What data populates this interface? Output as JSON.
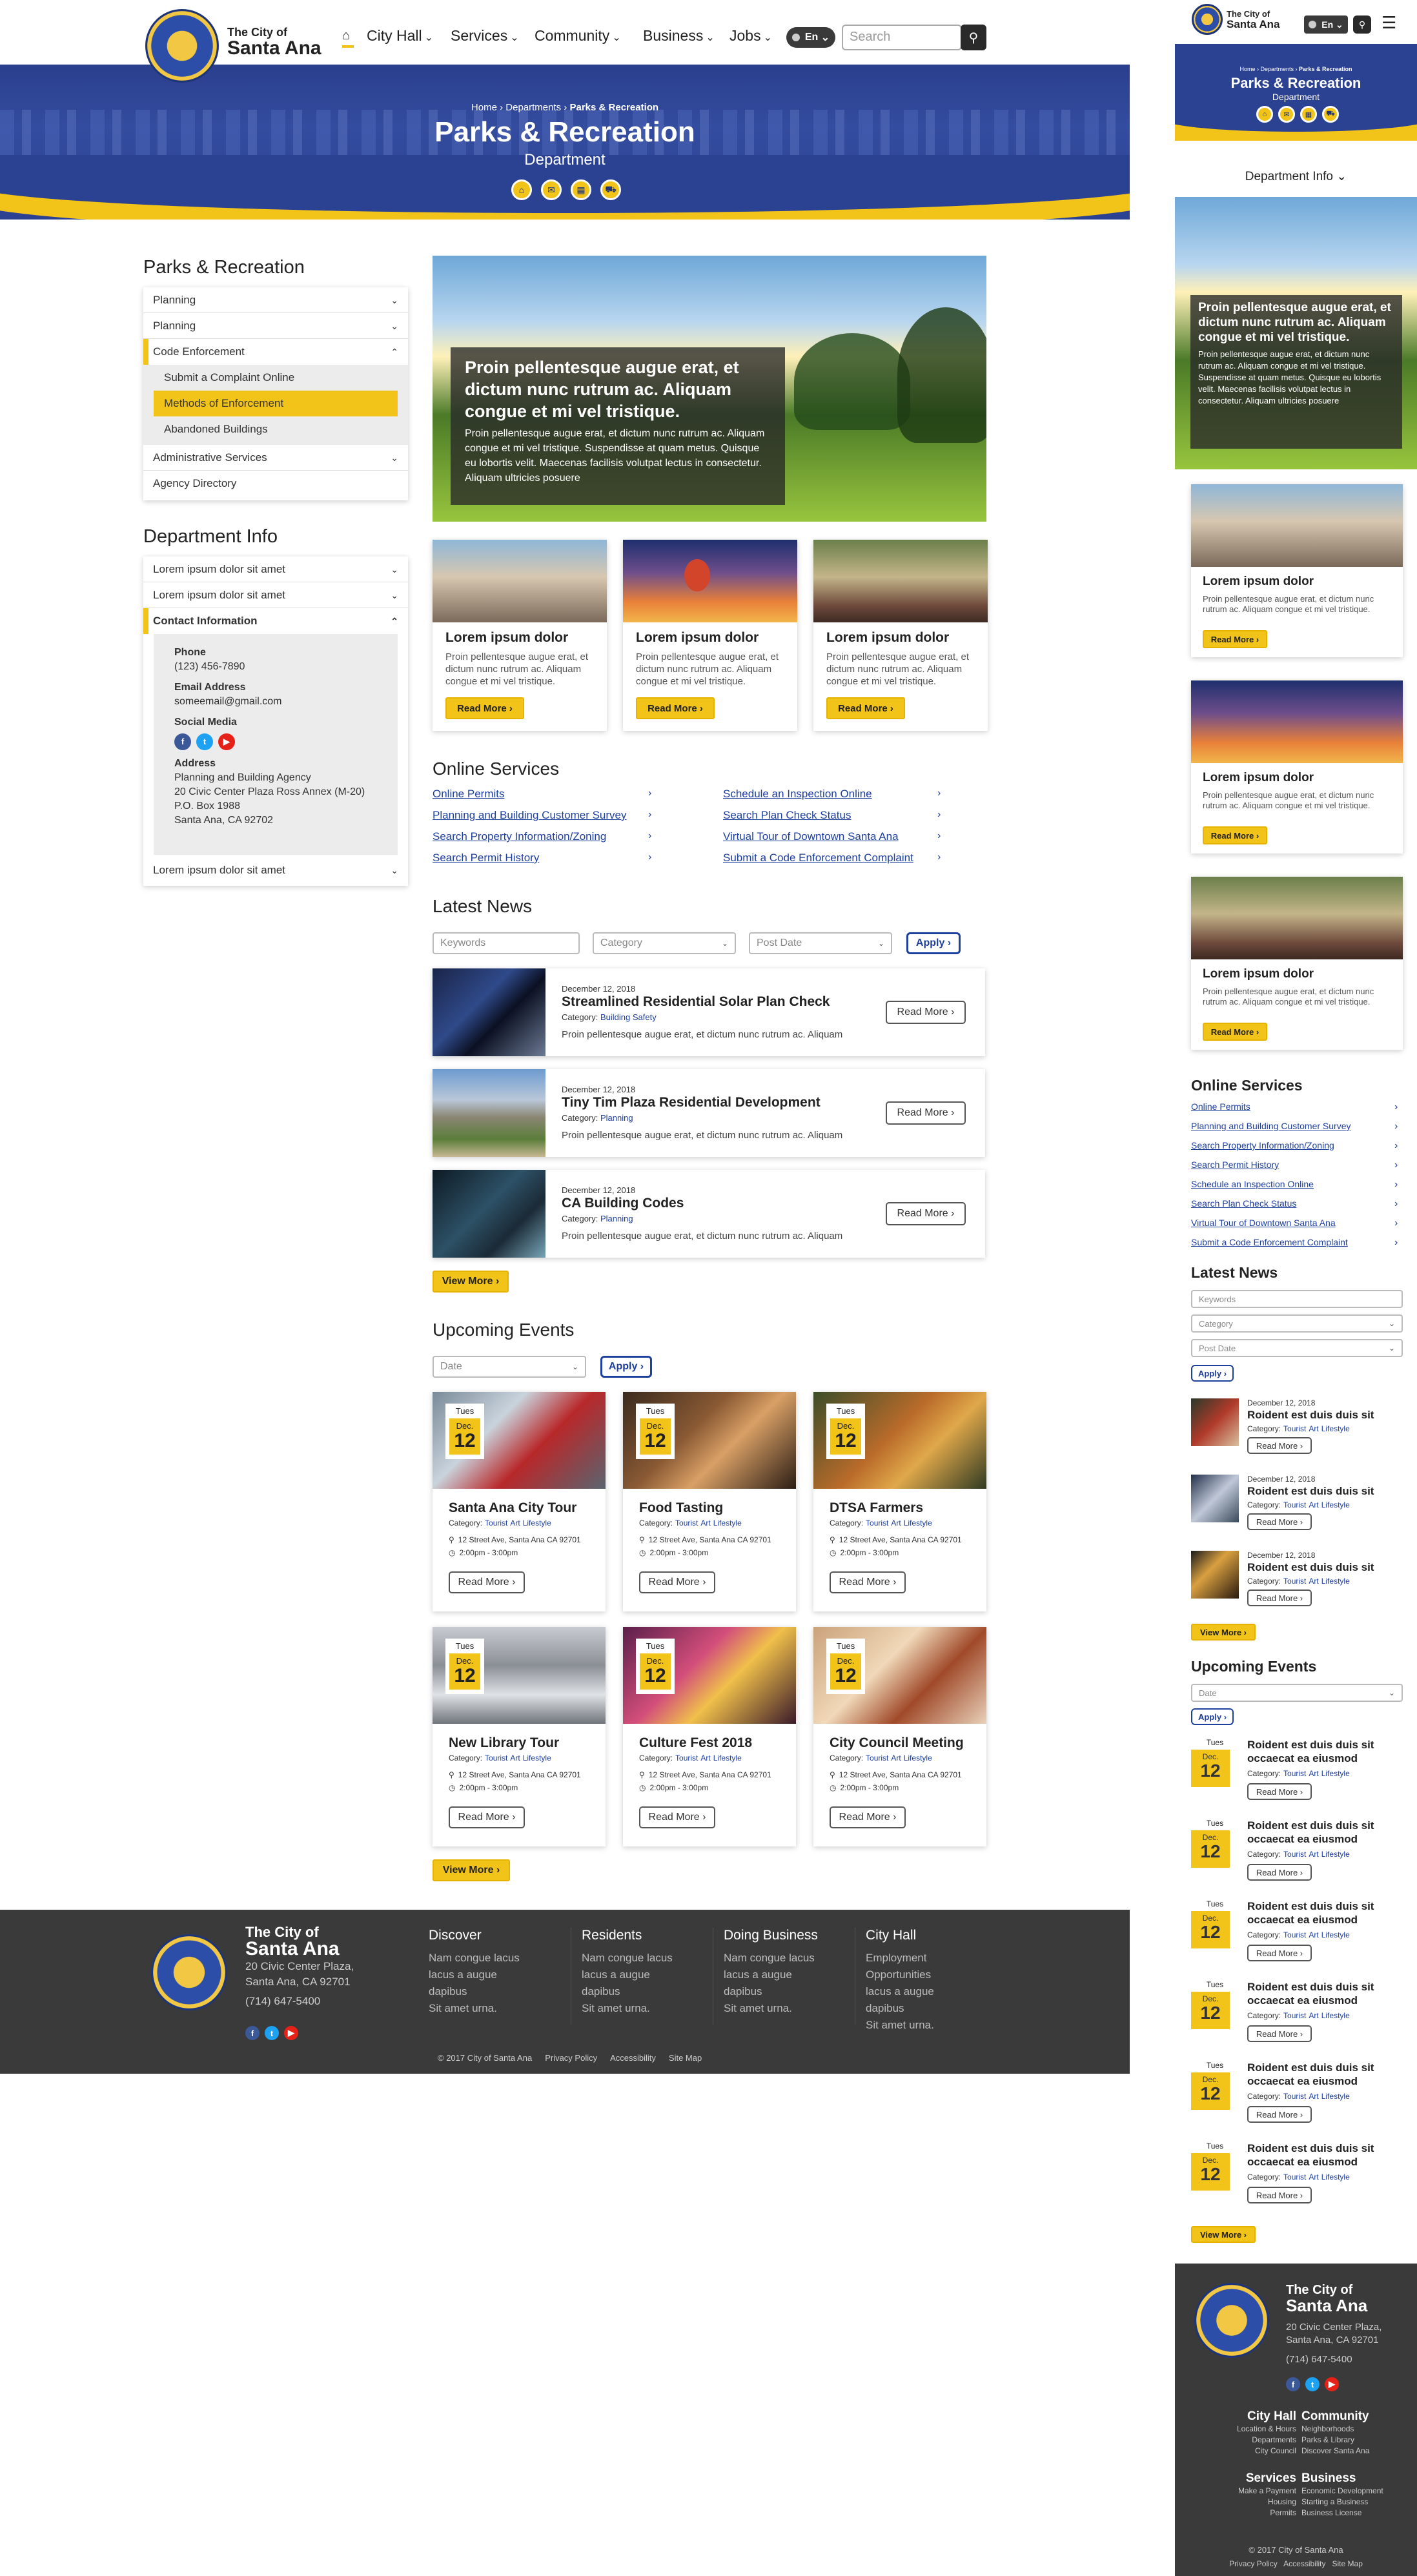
{
  "brand": {
    "line1": "The City of",
    "line2": "Santa Ana"
  },
  "nav": [
    "City Hall",
    "Services",
    "Community",
    "Business",
    "Jobs"
  ],
  "lang": "En",
  "search_placeholder": "Search",
  "breadcrumb": {
    "home": "Home",
    "dept": "Departments",
    "current": "Parks & Recreation"
  },
  "hero": {
    "title": "Parks & Recreation",
    "subtitle": "Department"
  },
  "sidebar": {
    "title": "Parks & Recreation",
    "items": [
      "Planning",
      "Planning",
      "Code Enforcement"
    ],
    "sub": [
      "Submit a Complaint Online",
      "Methods of Enforcement",
      "Abandoned Buildings"
    ],
    "items2": [
      "Administrative Services",
      "Agency Directory"
    ],
    "info_title": "Department Info",
    "info_items": [
      "Lorem ipsum dolor sit amet",
      "Lorem ipsum dolor sit amet",
      "Contact Information",
      "Lorem ipsum dolor sit amet"
    ],
    "contact": {
      "phone_label": "Phone",
      "phone": "(123) 456-7890",
      "email_label": "Email Address",
      "email": "someemail@gmail.com",
      "social_label": "Social Media",
      "address_label": "Address",
      "address": [
        "Planning and Building Agency",
        "20 Civic Center Plaza Ross Annex (M-20)",
        "P.O. Box 1988",
        "Santa Ana, CA 92702"
      ]
    }
  },
  "featured": {
    "title": "Proin pellentesque augue erat, et dictum nunc rutrum ac. Aliquam congue et mi vel tristique.",
    "body": "Proin pellentesque augue erat, et dictum nunc rutrum ac. Aliquam congue et mi vel tristique. Suspendisse at quam metus. Quisque eu lobortis velit. Maecenas facilisis volutpat lectus in consectetur. Aliquam ultricies posuere"
  },
  "cards": [
    {
      "title": "Lorem ipsum dolor",
      "body": "Proin pellentesque augue erat, et dictum nunc rutrum ac. Aliquam congue et mi vel tristique.",
      "btn": "Read More ›"
    },
    {
      "title": "Lorem ipsum dolor",
      "body": "Proin pellentesque augue erat, et dictum nunc rutrum ac. Aliquam congue et mi vel tristique.",
      "btn": "Read More ›"
    },
    {
      "title": "Lorem ipsum dolor",
      "body": "Proin pellentesque augue erat, et dictum nunc rutrum ac. Aliquam congue et mi vel tristique.",
      "btn": "Read More ›"
    }
  ],
  "online": {
    "title": "Online Services",
    "links": [
      "Online Permits",
      "Planning and Building Customer Survey",
      "Search Property Information/Zoning",
      "Search Permit History",
      "Schedule an Inspection Online",
      "Search Plan Check Status",
      "Virtual Tour of Downtown Santa Ana",
      "Submit a Code Enforcement Complaint"
    ]
  },
  "news": {
    "title": "Latest News",
    "filters": {
      "keywords": "Keywords",
      "category": "Category",
      "date": "Post Date",
      "apply": "Apply ›"
    },
    "items": [
      {
        "date": "December 12, 2018",
        "title": "Streamlined Residential Solar Plan Check",
        "category": "Building Safety",
        "body": "Proin pellentesque augue erat, et dictum nunc rutrum ac. Aliquam",
        "btn": "Read More ›"
      },
      {
        "date": "December 12, 2018",
        "title": "Tiny Tim Plaza Residential Development",
        "category": "Planning",
        "body": "Proin pellentesque augue erat, et dictum nunc rutrum ac. Aliquam",
        "btn": "Read More ›"
      },
      {
        "date": "December 12, 2018",
        "title": "CA Building Codes",
        "category": "Planning",
        "body": "Proin pellentesque augue erat, et dictum nunc rutrum ac. Aliquam",
        "btn": "Read More ›"
      }
    ],
    "cat_label": "Category:",
    "more": "View More ›"
  },
  "events": {
    "title": "Upcoming Events",
    "date_filter": "Date",
    "apply": "Apply ›",
    "day": "Tues",
    "month": "Dec.",
    "num": "12",
    "cat_label": "Category:",
    "tags": [
      "Tourist",
      "Art",
      "Lifestyle"
    ],
    "addr": "12 Street Ave, Santa Ana CA 92701",
    "time": "2:00pm - 3:00pm",
    "btn": "Read More ›",
    "more": "View More ›",
    "items": [
      "Santa Ana City Tour",
      "Food Tasting",
      "DTSA Farmers",
      "New Library Tour",
      "Culture Fest 2018",
      "City Council Meeting"
    ]
  },
  "footer": {
    "addr1": "20 Civic Center Plaza,",
    "addr2": "Santa Ana, CA 92701",
    "phone": "(714) 647-5400",
    "cols": [
      {
        "h": "Discover",
        "l": [
          "Nam congue lacus",
          "lacus a augue",
          "dapibus",
          "Sit amet urna."
        ]
      },
      {
        "h": "Residents",
        "l": [
          "Nam congue lacus",
          "lacus a augue",
          "dapibus",
          "Sit amet urna."
        ]
      },
      {
        "h": "Doing Business",
        "l": [
          "Nam congue lacus",
          "lacus a augue",
          "dapibus",
          "Sit amet urna."
        ]
      },
      {
        "h": "City Hall",
        "l": [
          "Employment Opportunities",
          "lacus a augue",
          "dapibus",
          "Sit amet urna."
        ]
      }
    ],
    "copy": "© 2017 City of Santa Ana",
    "policy": "Privacy Policy",
    "access": "Accessibility",
    "sitemap": "Site Map"
  },
  "mobile": {
    "dept_info": "Department Info",
    "news_title": "Roident est duis duis sit",
    "event_title": "Roident est duis duis sit occaecat ea eiusmod",
    "cat_tags": [
      "Tourist",
      "Art",
      "Lifestyle"
    ],
    "foot_cols": [
      {
        "h": "City Hall",
        "l": [
          "Location & Hours",
          "Departments",
          "City Council"
        ]
      },
      {
        "h": "Community",
        "l": [
          "Neighborhoods",
          "Parks & Library",
          "Discover Santa Ana"
        ]
      },
      {
        "h": "Services",
        "l": [
          "Make a Payment",
          "Housing",
          "Permits"
        ]
      },
      {
        "h": "Business",
        "l": [
          "Economic Development",
          "Starting a Business",
          "Business License"
        ]
      }
    ]
  },
  "colors": {
    "accent": "#f2c319",
    "brand": "#2b4192",
    "footer": "#3a3a3a"
  }
}
